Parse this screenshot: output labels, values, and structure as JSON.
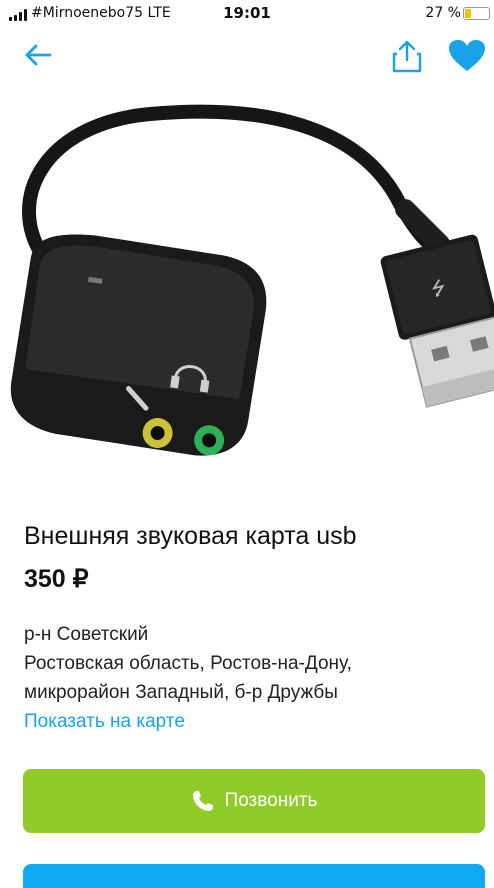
{
  "status_bar": {
    "carrier": "#Mirnoenebo75  LTE",
    "time": "19:01",
    "battery_text": "27 %",
    "battery_level": 0.27,
    "battery_color": "#f2c200"
  },
  "nav": {
    "back_icon": "arrow-left-icon",
    "share_icon": "share-icon",
    "favorite_icon": "heart-icon",
    "accent_color": "#1aa3e8"
  },
  "product": {
    "image": "usb-sound-card-photo",
    "title": "Внешняя звуковая карта usb",
    "price": "350 ₽",
    "district": "р-н Советский",
    "address_line1": "Ростовская область, Ростов-на-Дону,",
    "address_line2": "микрорайон Западный, б-р Дружбы",
    "map_link": "Показать на карте"
  },
  "actions": {
    "call_label": "Позвонить",
    "call_icon": "phone-icon",
    "call_color": "#8fcc2a",
    "message_color": "#11a9f0"
  }
}
